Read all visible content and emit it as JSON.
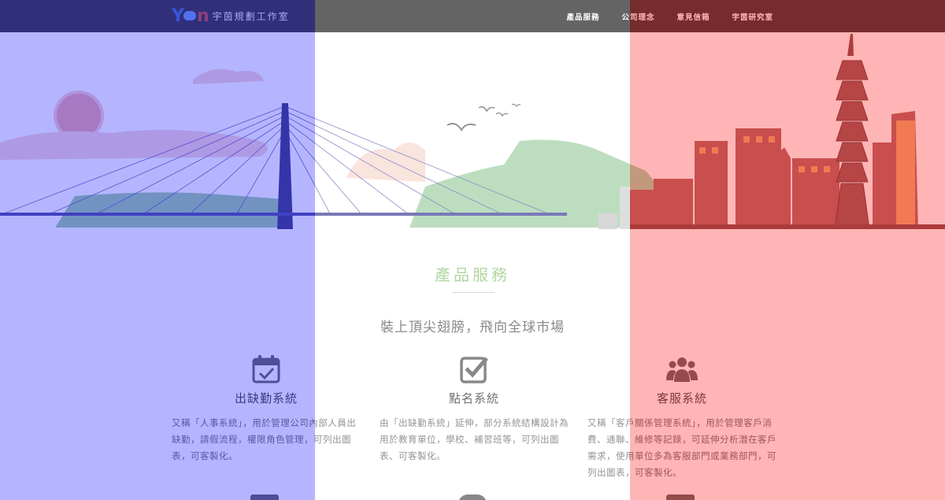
{
  "brand": {
    "logo_y": "Y",
    "logo_n": "n",
    "name": "宇茵規劃工作室"
  },
  "nav": {
    "items": [
      {
        "label": "產品服務"
      },
      {
        "label": "公司理念"
      },
      {
        "label": "意見信箱"
      },
      {
        "label": "宇茵研究室"
      }
    ]
  },
  "section": {
    "title": "產品服務",
    "subtitle": "裝上頂尖翅膀，飛向全球市場",
    "features": [
      {
        "icon": "calendar-check-icon",
        "title": "出缺勤系統",
        "text": "又稱「人事系統」，用於管理公司內部人員出缺勤，請假流程，權限角色管理，可列出圖表，可客製化。"
      },
      {
        "icon": "checkbox-icon",
        "title": "點名系統",
        "text": "由「出缺勤系統」延伸，部分系統結構設計為用於教育單位，學校、補習班等，可列出圖表、可客製化。"
      },
      {
        "icon": "users-icon",
        "title": "客服系統",
        "text": "又稱「客戶關係管理系統」，用於管理客戶消費、通聯、維修等記錄，可延伸分析潛在客戶需求，使用單位多為客服部門或業務部門，可列出圖表，可客製化。"
      }
    ]
  },
  "colors": {
    "accent": "#8fc77a",
    "navbar": "#222222",
    "overlay_left": "#4646ff",
    "overlay_right": "#ff3c3c"
  }
}
